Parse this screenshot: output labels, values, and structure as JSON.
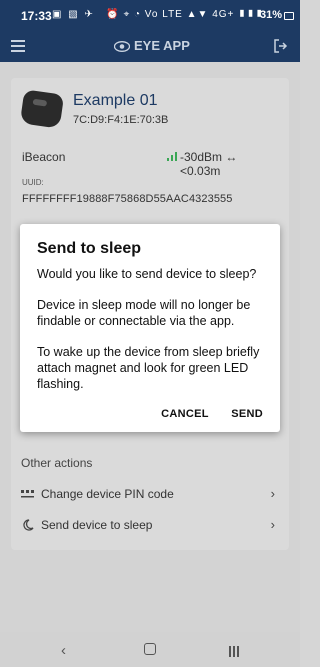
{
  "status_bar": {
    "time": "17:33",
    "left_icons": "▣ ▧ ✈",
    "right_icons": "⏰ ⌖ ◔ Vo LTE ▲▼ 4G+ ▮▮▮",
    "battery": "31%"
  },
  "app_bar": {
    "title": "EYE APP",
    "menu_icon": "menu-icon",
    "logout_icon": "logout-icon"
  },
  "device": {
    "name": "Example 01",
    "mac": "7C:D9:F4:1E:70:3B",
    "beacon_type": "iBeacon",
    "rssi": "-30dBm ↔ <0.03m",
    "uuid_label": "UUID:",
    "uuid": "FFFFFFFF19888F75868D55AAC4323555"
  },
  "other_actions": {
    "heading": "Other actions",
    "items": [
      {
        "label": "Change device PIN code",
        "icon": "pin-dots-icon"
      },
      {
        "label": "Send device to sleep",
        "icon": "moon-icon"
      }
    ]
  },
  "dialog": {
    "title": "Send to sleep",
    "question": "Would you like to send device to sleep?",
    "warning": " Device in sleep mode will no longer be findable or connectable via the app.",
    "instructions": " To wake up the device from sleep briefly attach magnet and look for green LED flashing.",
    "cancel_label": "CANCEL",
    "send_label": "SEND"
  },
  "colors": {
    "header": "#1d3a63",
    "overlay": "#d3d3d3",
    "accent_signal": "#3aa655"
  }
}
